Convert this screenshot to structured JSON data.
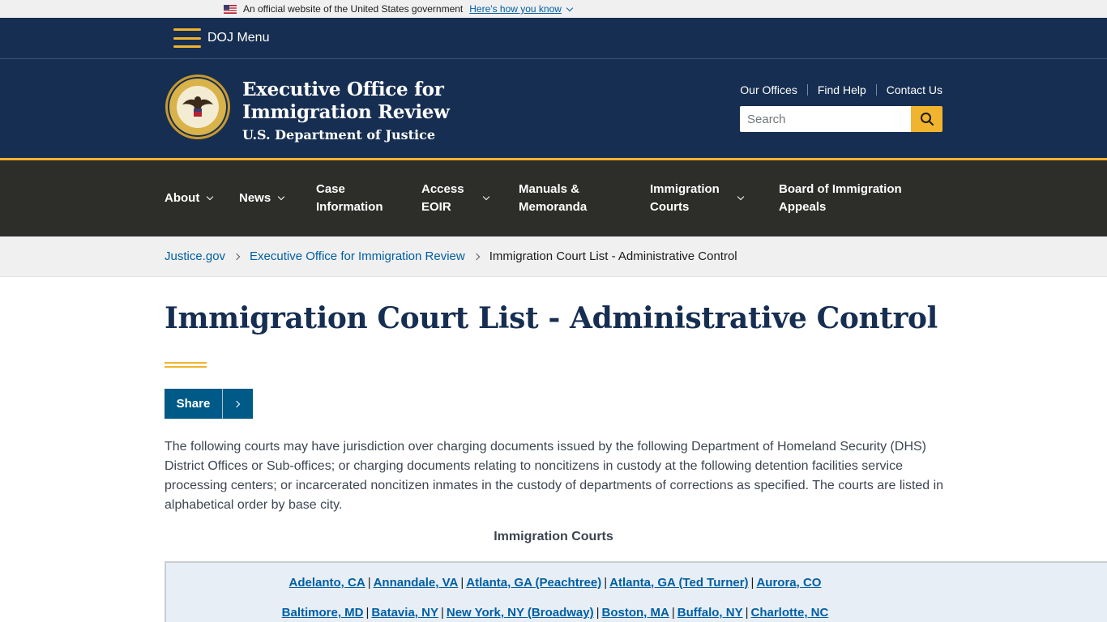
{
  "gov_banner": {
    "text": "An official website of the United States government",
    "link": "Here's how you know"
  },
  "doj_menu": {
    "label": "DOJ Menu"
  },
  "header": {
    "org_line1": "Executive Office for",
    "org_line2": "Immigration Review",
    "org_line3": "U.S. Department of Justice",
    "util_links": [
      "Our Offices",
      "Find Help",
      "Contact Us"
    ],
    "search_placeholder": "Search"
  },
  "nav": {
    "items": [
      {
        "line1": "About",
        "line2": "",
        "dropdown": true
      },
      {
        "line1": "News",
        "line2": "",
        "dropdown": true
      },
      {
        "line1": "Case",
        "line2": "Information",
        "dropdown": false
      },
      {
        "line1": "Access",
        "line2": "EOIR",
        "dropdown": true
      },
      {
        "line1": "Manuals &",
        "line2": "Memoranda",
        "dropdown": false
      },
      {
        "line1": "Immigration",
        "line2": "Courts",
        "dropdown": true
      },
      {
        "line1": "Board of Immigration",
        "line2": "Appeals",
        "dropdown": false
      }
    ]
  },
  "breadcrumb": {
    "items": [
      "Justice.gov",
      "Executive Office for Immigration Review"
    ],
    "current": "Immigration Court List - Administrative Control"
  },
  "page": {
    "title": "Immigration Court List - Administrative Control",
    "share_label": "Share",
    "intro": "The following courts may have jurisdiction over charging documents issued by the following Department of Homeland Security (DHS) District Offices or Sub-offices; or charging documents relating to noncitizens in custody at the following detention facilities service processing centers; or incarcerated noncitizen inmates in the custody of departments of corrections as specified. The courts are listed in alphabetical order by base city.",
    "courts_heading": "Immigration Courts",
    "courts_rows": [
      [
        "Adelanto, CA",
        "Annandale, VA",
        "Atlanta, GA (Peachtree)",
        "Atlanta, GA (Ted Turner)",
        "Aurora, CO"
      ],
      [
        "Baltimore, MD",
        "Batavia, NY",
        "New York, NY (Broadway)",
        "Boston, MA",
        "Buffalo, NY",
        "Charlotte, NC"
      ]
    ]
  },
  "colors": {
    "navy": "#162e51",
    "gold": "#f1b42f",
    "nav_bg": "#2d2d2a",
    "link": "#005ea2"
  }
}
